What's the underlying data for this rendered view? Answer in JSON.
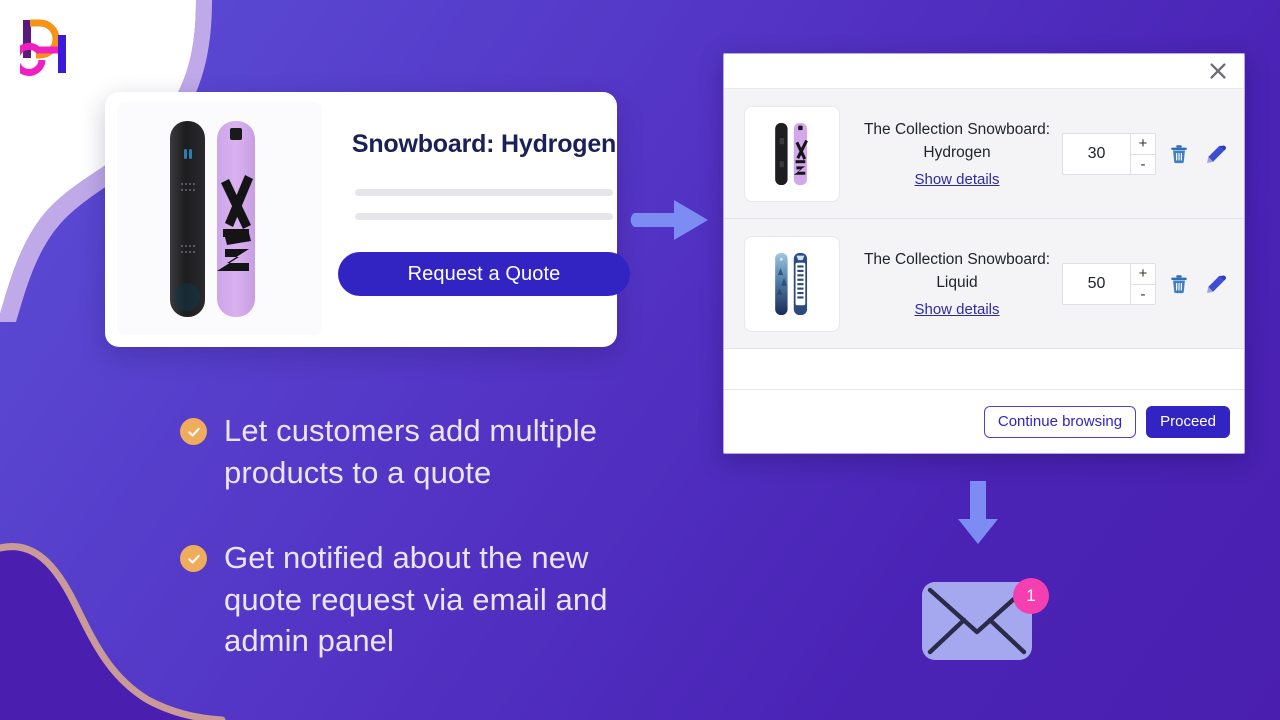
{
  "brand": {
    "logo_name": "brand-logo-de",
    "colors": {
      "orange": "#f79318",
      "magenta": "#f01fc1",
      "dark_purple": "#5a1a7a",
      "indigo": "#3b1bd9",
      "background_purple": "#5436c6",
      "accent_blue": "#3124c2",
      "check_orange": "#eeac5c",
      "badge_pink": "#f43fb1",
      "arrow_blue": "#7d8cf2"
    }
  },
  "product_card": {
    "title": "Snowboard: Hydrogen",
    "cta_label": "Request a Quote",
    "image_alt": "snowboard-hydrogen-pair",
    "placeholder_lines": 2
  },
  "flow": {
    "arrow_right_name": "arrow-right-icon",
    "arrow_down_name": "arrow-down-icon"
  },
  "cart_modal": {
    "close_label": "✕",
    "items": [
      {
        "title": "The Collection Snowboard:",
        "variant": "Hydrogen",
        "details_link": "Show details",
        "quantity": "30",
        "increment_label": "+",
        "decrement_label": "-",
        "thumb_alt": "snowboard-hydrogen-thumb"
      },
      {
        "title": "The Collection Snowboard:",
        "variant": "Liquid",
        "details_link": "Show details",
        "quantity": "50",
        "increment_label": "+",
        "decrement_label": "-",
        "thumb_alt": "snowboard-liquid-thumb"
      }
    ],
    "footer": {
      "secondary_label": "Continue browsing",
      "primary_label": "Proceed"
    }
  },
  "features": [
    {
      "text": "Let customers add multiple products to a quote"
    },
    {
      "text": "Get notified about the new quote request via email and admin panel"
    }
  ],
  "notification": {
    "count": "1",
    "mail_icon_name": "envelope-icon"
  }
}
